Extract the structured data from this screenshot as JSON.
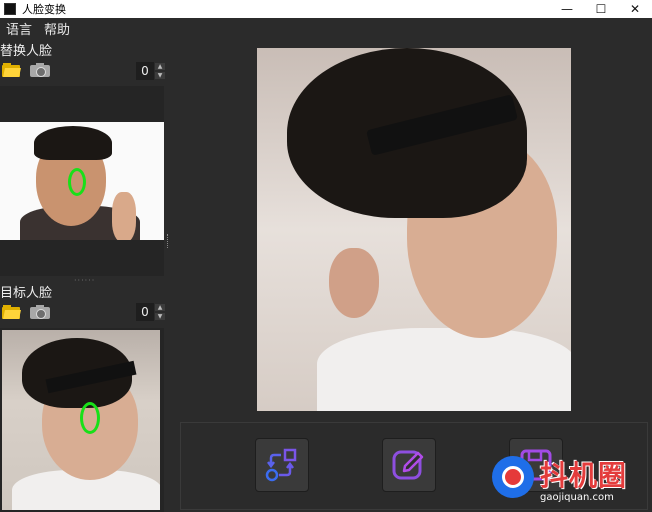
{
  "window": {
    "title": "人脸变换",
    "controls": {
      "minimize": "—",
      "maximize": "☐",
      "close": "✕"
    }
  },
  "menu": {
    "items": [
      "语言",
      "帮助"
    ]
  },
  "left_panel": {
    "swap_section": {
      "label": "替换人脸",
      "stepper_value": "0"
    },
    "target_section": {
      "label": "目标人脸",
      "stepper_value": "0"
    },
    "splitter_dots": "······"
  },
  "actions": {
    "swap_icon": "swap-arrows-icon",
    "edit_icon": "edit-pencil-icon",
    "save_icon": "save-icon"
  },
  "watermark": {
    "brand": "抖机圈",
    "url": "gaojiquan.com"
  },
  "colors": {
    "accent_purple": "#8e4fe0",
    "accent_blue": "#3b6cf0",
    "green_marker": "#19e019"
  }
}
